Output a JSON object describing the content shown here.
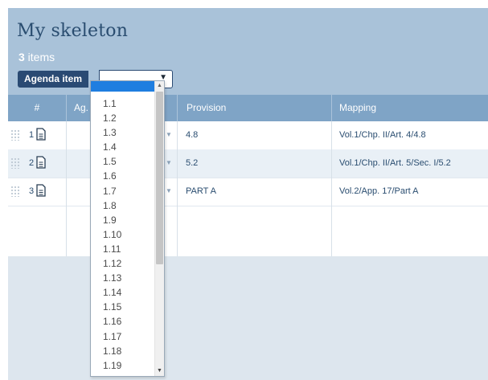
{
  "header": {
    "title": "My skeleton",
    "count_number": "3",
    "count_label": " items",
    "filter_label": "Agenda item",
    "filter_value": ""
  },
  "table": {
    "columns": {
      "hash": "#",
      "agenda": "Ag.",
      "provision": "Provision",
      "mapping": "Mapping"
    },
    "rows": [
      {
        "num": "1",
        "provision": "4.8",
        "mapping": "Vol.1/Chp. II/Art. 4/4.8"
      },
      {
        "num": "2",
        "provision": "5.2",
        "mapping": "Vol.1/Chp. II/Art. 5/Sec. I/5.2"
      },
      {
        "num": "3",
        "provision": "PART A",
        "mapping": "Vol.2/App. 17/Part A"
      }
    ]
  },
  "dropdown": {
    "selected": "",
    "options": [
      "1.1",
      "1.2",
      "1.3",
      "1.4",
      "1.5",
      "1.6",
      "1.7",
      "1.8",
      "1.9",
      "1.10",
      "1.11",
      "1.12",
      "1.13",
      "1.14",
      "1.15",
      "1.16",
      "1.17",
      "1.18",
      "1.19"
    ]
  },
  "icons": {
    "doc": "document-icon",
    "handle": "drag-handle-icon",
    "arrow": "chevron-down-icon"
  },
  "colors": {
    "header_bg": "#a9c2d9",
    "title": "#2a4d70",
    "filter_label_bg": "#2a4a73",
    "table_header_bg": "#7fa4c6",
    "row_alt_bg": "#e9f0f6",
    "dropdown_selected_bg": "#1f7ee0",
    "page_bg_lower": "#dde6ee"
  }
}
